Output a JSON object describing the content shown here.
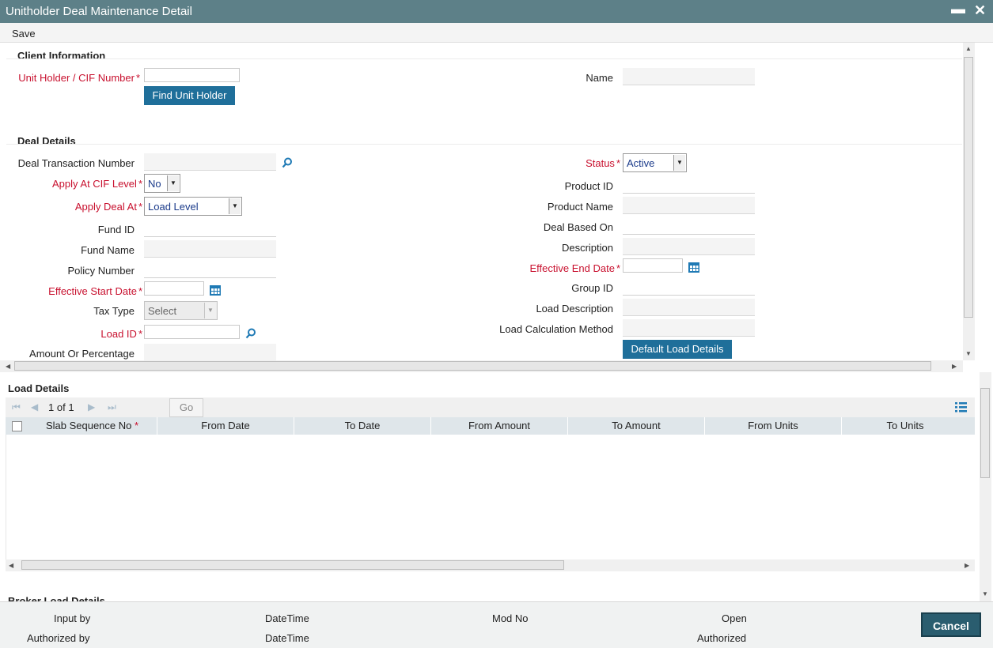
{
  "window": {
    "title": "Unitholder Deal Maintenance Detail",
    "minimize_glyph": "▬",
    "close_glyph": "✕"
  },
  "toolbar": {
    "save_label": "Save"
  },
  "client_info": {
    "heading": "Client Information",
    "unit_holder_label": "Unit Holder / CIF Number",
    "unit_holder_value": "",
    "find_button": "Find Unit Holder",
    "name_label": "Name",
    "name_value": ""
  },
  "deal_details": {
    "heading": "Deal Details",
    "deal_txn_label": "Deal Transaction Number",
    "apply_cif_label": "Apply At CIF Level",
    "apply_cif_value": "No",
    "apply_deal_label": "Apply Deal At",
    "apply_deal_value": "Load Level",
    "fund_id_label": "Fund ID",
    "fund_name_label": "Fund Name",
    "policy_label": "Policy Number",
    "eff_start_label": "Effective Start Date",
    "tax_type_label": "Tax Type",
    "tax_type_value": "Select",
    "load_id_label": "Load ID",
    "amount_pct_label": "Amount Or Percentage",
    "status_label": "Status",
    "status_value": "Active",
    "product_id_label": "Product ID",
    "product_name_label": "Product Name",
    "deal_based_label": "Deal Based On",
    "description_label": "Description",
    "eff_end_label": "Effective End Date",
    "group_id_label": "Group ID",
    "load_desc_label": "Load Description",
    "load_calc_label": "Load Calculation Method",
    "default_load_button": "Default Load Details"
  },
  "required_marker": "*",
  "load_details": {
    "heading": "Load Details",
    "page_current": "1",
    "page_of": "of",
    "page_total": "1",
    "go_label": "Go",
    "columns": [
      "Slab Sequence No",
      "From Date",
      "To Date",
      "From Amount",
      "To Amount",
      "From Units",
      "To Units"
    ],
    "rows": []
  },
  "peek_section": {
    "heading": "Broker Load Details"
  },
  "footer": {
    "input_by": "Input by",
    "authorized_by": "Authorized by",
    "datetime_1": "DateTime",
    "datetime_2": "DateTime",
    "mod_no": "Mod No",
    "open": "Open",
    "authorized": "Authorized",
    "cancel": "Cancel"
  },
  "colors": {
    "title_bar": "#5d8088",
    "button_blue": "#1f6f9a",
    "required_red": "#c8102e",
    "cancel": "#2a5d6f"
  },
  "icons": {
    "search": "search-icon",
    "calendar": "calendar-icon",
    "columns": "column-settings-icon"
  }
}
